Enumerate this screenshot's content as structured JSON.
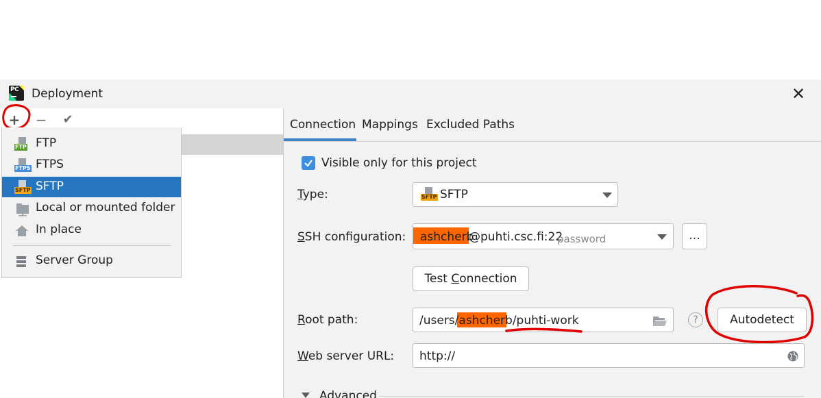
{
  "window": {
    "title": "Deployment",
    "close_label": "✕"
  },
  "toolbar": {
    "add": "+",
    "remove": "−",
    "apply": "✔"
  },
  "add_menu": {
    "items": [
      {
        "label": "FTP",
        "icon": "ftp-icon",
        "tag": "FTP",
        "tag_color": "#5aa02c"
      },
      {
        "label": "FTPS",
        "icon": "ftps-icon",
        "tag": "FTPS",
        "tag_color": "#3d8ee0"
      },
      {
        "label": "SFTP",
        "icon": "sftp-icon",
        "tag": "SFTP",
        "tag_color": "#f0a30a",
        "selected": true
      },
      {
        "label": "Local or mounted folder",
        "icon": "folder-icon"
      },
      {
        "label": "In place",
        "icon": "home-icon"
      },
      {
        "label": "Server Group",
        "icon": "server-group-icon"
      }
    ]
  },
  "tabs": [
    {
      "label": "Connection",
      "active": true
    },
    {
      "label": "Mappings"
    },
    {
      "label": "Excluded Paths"
    }
  ],
  "connection": {
    "visible_only_label": "Visible only for this project",
    "visible_only_checked": true,
    "type_label_first": "T",
    "type_label_rest": "ype:",
    "type_value": "SFTP",
    "ssh_label_first": "S",
    "ssh_label_rest": "SH configuration:",
    "ssh_user": "ashcherb",
    "ssh_host": "@puhti.csc.fi:22",
    "ssh_auth": "password",
    "ssh_more": "...",
    "test_label_pre": "Test ",
    "test_label_u": "C",
    "test_label_post": "onnection",
    "root_label_first": "R",
    "root_label_rest": "oot path:",
    "root_pre": "/users/",
    "root_user": "ashcherb",
    "root_post": "/puhti-work",
    "help": "?",
    "autodetect_label": "Autodetect",
    "web_label_first": "W",
    "web_label_rest": "eb server URL:",
    "web_value": "http://",
    "advanced_label": "Advanced"
  },
  "colors": {
    "accent": "#4083c9",
    "selection": "#2675bf",
    "redaction": "#ff6600",
    "annotation": "#e00000"
  }
}
